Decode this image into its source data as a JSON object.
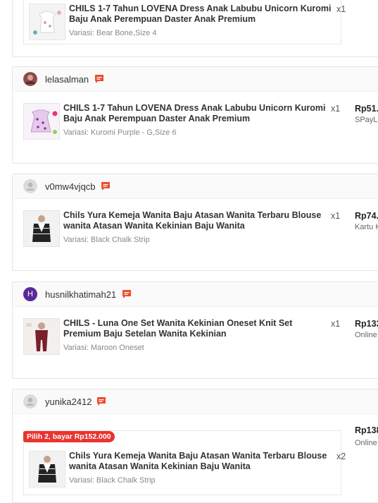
{
  "orders": [
    {
      "username": "",
      "items": [
        {
          "name": "CHILS 1-7 Tahun LOVENA Dress Anak Labubu Unicorn Kuromi Baju Anak Perempuan Daster Anak Premium",
          "qty": "x1",
          "variation": "Variasi: Bear Bone,Size 4"
        }
      ]
    },
    {
      "username": "lelasalman",
      "items": [
        {
          "name": "CHILS 1-7 Tahun LOVENA Dress Anak Labubu Unicorn Kuromi Baju Anak Perempuan Daster Anak Premium",
          "qty": "x1",
          "variation": "Variasi: Kuromi Purple - G,Size 6",
          "price": "Rp51.",
          "payment": "SPayLa"
        }
      ]
    },
    {
      "username": "v0mw4vjqcb",
      "items": [
        {
          "name": "Chils Yura Kemeja Wanita Baju Atasan Wanita Terbaru Blouse wanita Atasan Wanita Kekinian Baju Wanita",
          "qty": "x1",
          "variation": "Variasi: Black Chalk Strip",
          "price": "Rp74.",
          "payment": "Kartu K"
        }
      ]
    },
    {
      "username": "husnilkhatimah21",
      "avatar_letter": "H",
      "items": [
        {
          "name": "CHILS - Luna One Set Wanita Kekinian Oneset Knit Set Premium Baju Setelan Wanita Kekinian",
          "qty": "x1",
          "variation": "Variasi: Maroon Oneset",
          "price": "Rp133",
          "payment": "Online"
        }
      ]
    },
    {
      "username": "yunika2412",
      "promo": "Pilih 2, bayar Rp152.000",
      "items": [
        {
          "name": "Chils Yura Kemeja Wanita Baju Atasan Wanita Terbaru Blouse wanita Atasan Wanita Kekinian Baju Wanita",
          "qty": "x2",
          "variation": "Variasi: Black Chalk Strip",
          "price": "Rp138",
          "payment": "Online"
        }
      ]
    }
  ],
  "colors": {
    "accent": "#ee4d2d",
    "promo": "#e8352f"
  },
  "icons": {
    "chat": "chat-icon",
    "default_avatar": "user-icon"
  }
}
